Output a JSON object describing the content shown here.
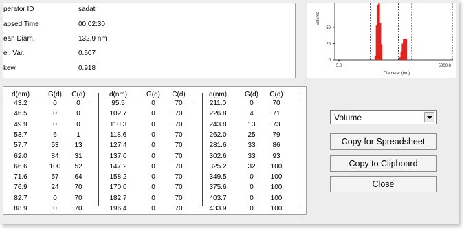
{
  "info": {
    "rows": [
      {
        "label": "perator ID",
        "value": "sadat"
      },
      {
        "label": "apsed Time",
        "value": "00:02:30"
      },
      {
        "label": "ean Diam.",
        "value": "132.9 nm"
      },
      {
        "label": "el. Var.",
        "value": "0.607"
      },
      {
        "label": "kew",
        "value": "0.918"
      }
    ]
  },
  "chart_data": {
    "type": "bar",
    "ylabel": "Volume",
    "xlabel": "Diameter (nm)",
    "y_ticks": [
      "50",
      "25",
      "0"
    ],
    "x_ticks": [
      "5.0",
      "5000.0"
    ],
    "ylim": [
      0,
      100
    ],
    "xlim": [
      5.0,
      5000.0
    ],
    "xscale": "log",
    "x": [
      43.2,
      46.5,
      49.9,
      53.7,
      57.7,
      62.0,
      66.6,
      71.6,
      76.9,
      82.7,
      88.9,
      95.5,
      102.7,
      110.3,
      118.6,
      127.4,
      137.0,
      147.2,
      158.2,
      170.0,
      182.7,
      196.4,
      211.0,
      226.8,
      243.8,
      262.0,
      281.6,
      302.6,
      325.2,
      349.5,
      375.6,
      403.7,
      433.9
    ],
    "values": [
      0,
      0,
      0,
      6,
      53,
      84,
      100,
      57,
      24,
      0,
      0,
      0,
      0,
      0,
      0,
      0,
      0,
      0,
      0,
      0,
      0,
      0,
      0,
      4,
      13,
      25,
      33,
      33,
      32,
      0,
      0,
      0,
      0
    ],
    "bar_color": "#e8201c",
    "cursor_color": "#1a1aa8"
  },
  "table": {
    "headers": [
      "d(nm)",
      "G(d)",
      "C(d)",
      "d(nm)",
      "G(d)",
      "C(d)",
      "d(nm)",
      "G(d)",
      "C(d)"
    ],
    "rows": [
      [
        "43.2",
        "0",
        "0",
        "95.5",
        "0",
        "70",
        "211.0",
        "0",
        "70"
      ],
      [
        "46.5",
        "0",
        "0",
        "102.7",
        "0",
        "70",
        "226.8",
        "4",
        "71"
      ],
      [
        "49.9",
        "0",
        "0",
        "110.3",
        "0",
        "70",
        "243.8",
        "13",
        "73"
      ],
      [
        "53.7",
        "6",
        "1",
        "118.6",
        "0",
        "70",
        "262.0",
        "25",
        "79"
      ],
      [
        "57.7",
        "53",
        "13",
        "127.4",
        "0",
        "70",
        "281.6",
        "33",
        "86"
      ],
      [
        "62.0",
        "84",
        "31",
        "137.0",
        "0",
        "70",
        "302.6",
        "33",
        "93"
      ],
      [
        "66.6",
        "100",
        "52",
        "147.2",
        "0",
        "70",
        "325.2",
        "32",
        "100"
      ],
      [
        "71.6",
        "57",
        "64",
        "158.2",
        "0",
        "70",
        "349.5",
        "0",
        "100"
      ],
      [
        "76.9",
        "24",
        "70",
        "170.0",
        "0",
        "70",
        "375.6",
        "0",
        "100"
      ],
      [
        "82.7",
        "0",
        "70",
        "182.7",
        "0",
        "70",
        "403.7",
        "0",
        "100"
      ],
      [
        "88.9",
        "0",
        "70",
        "196.4",
        "0",
        "70",
        "433.9",
        "0",
        "100"
      ]
    ]
  },
  "controls": {
    "distribution_select": {
      "value": "Volume",
      "icon": "chevron-down-icon"
    },
    "copy_spreadsheet_label": "Copy for Spreadsheet",
    "copy_clipboard_label": "Copy to Clipboard",
    "close_label": "Close"
  }
}
